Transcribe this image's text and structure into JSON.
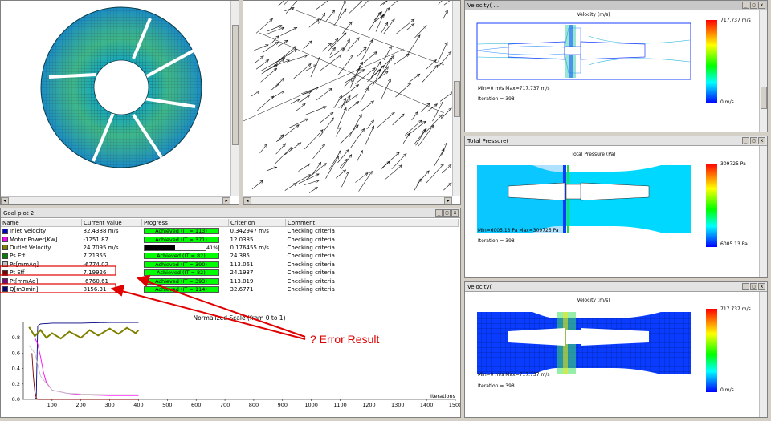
{
  "panes": {
    "velocity_top_title": "Velocity( ... ",
    "total_pressure_title": "Total Pressure(",
    "velocity_bottom_title": "Velocity("
  },
  "goal_plot": {
    "title": "Goal plot 2",
    "headers": [
      "Name",
      "Current Value",
      "Progress",
      "Criterion",
      "Comment"
    ],
    "rows": [
      {
        "name": "Inlet Velocity",
        "value": "82.4388 m/s",
        "progress": "Achieved (IT = 113)",
        "criterion": "0.342947 m/s",
        "comment": "Checking criteria",
        "color": "#0000cc"
      },
      {
        "name": "Motor Power[Kw]",
        "value": "-1251.87",
        "progress": "Achieved (IT = 371)",
        "criterion": "12.0385",
        "comment": "Checking criteria",
        "color": "#ff00ff"
      },
      {
        "name": "Outlet Velocity",
        "value": "24.7095 m/s",
        "progress": "41%",
        "progress_fraction": 0.41,
        "criterion": "0.176455 m/s",
        "comment": "Checking criteria",
        "color": "#808000"
      },
      {
        "name": "Ps Eff",
        "value": "7.21355",
        "progress": "Achieved (IT = 82)",
        "criterion": "24.385",
        "comment": "Checking criteria",
        "color": "#008000"
      },
      {
        "name": "Ps[mmAq]",
        "value": "-6774.02",
        "progress": "Achieved (IT = 390)",
        "criterion": "113.061",
        "comment": "Checking criteria",
        "color": "#c0c0c0"
      },
      {
        "name": "Pt Eff",
        "value": "7.19926",
        "progress": "Achieved (IT = 82)",
        "criterion": "24.1937",
        "comment": "Checking criteria",
        "color": "#800000"
      },
      {
        "name": "Pt[mmAq]",
        "value": "-6760.61",
        "progress": "Achieved (IT = 393)",
        "criterion": "113.019",
        "comment": "Checking criteria",
        "color": "#800080"
      },
      {
        "name": "Q[m3min]",
        "value": "8156.31",
        "progress": "Achieved (IT = 114)",
        "criterion": "32.6771",
        "comment": "Checking criteria",
        "color": "#000080"
      }
    ]
  },
  "annotation": "? Error Result",
  "contours": {
    "top": {
      "title": "Velocity (m/s)",
      "max_label": "717.737 m/s",
      "min_label": "0 m/s",
      "minmax": "Min=0 m/s   Max=717.737 m/s",
      "iteration": "Iteration = 398"
    },
    "middle": {
      "title": "Total Pressure (Pa)",
      "max_label": "309725 Pa",
      "min_label": "6005.13 Pa",
      "minmax": "Min=6005.13 Pa   Max=309725 Pa",
      "iteration": "Iteration = 398"
    },
    "bottom": {
      "title": "Velocity (m/s)",
      "max_label": "717.737 m/s",
      "min_label": "0 m/s",
      "minmax": "Min=0 m/s   Max=717.737 m/s",
      "iteration": "Iteration = 398"
    }
  },
  "colors": {
    "colorbar_top": "#ff0000",
    "colorbar_bottom": "#0000ff",
    "annotation": "#e00000",
    "achieved": "#00ff00"
  },
  "chart_data": {
    "type": "line",
    "title": "Normalized Scale (from 0 to 1)",
    "xlabel": "Iterations",
    "ylabel": "",
    "xlim": [
      0,
      1500
    ],
    "ylim": [
      0,
      1.0
    ],
    "x_ticks": [
      100,
      200,
      300,
      400,
      500,
      600,
      700,
      800,
      900,
      1000,
      1100,
      1200,
      1300,
      1400,
      1500
    ],
    "y_ticks": [
      0.0,
      0.2,
      0.4,
      0.6,
      0.8
    ],
    "series": [
      {
        "color": "#000080",
        "x": [
          40,
          45,
          50,
          55,
          60,
          100,
          200,
          300,
          400
        ],
        "y": [
          0.0,
          0.02,
          0.95,
          0.97,
          0.98,
          0.99,
          0.99,
          1.0,
          1.0
        ]
      },
      {
        "color": "#ff00ff",
        "x": [
          40,
          50,
          60,
          70,
          80,
          100,
          150,
          200,
          300,
          400
        ],
        "y": [
          0.8,
          0.72,
          0.55,
          0.35,
          0.22,
          0.12,
          0.08,
          0.06,
          0.05,
          0.05
        ]
      },
      {
        "color": "#808000",
        "x": [
          20,
          40,
          60,
          80,
          100,
          130,
          160,
          200,
          230,
          260,
          300,
          330,
          360,
          390,
          400
        ],
        "y": [
          0.94,
          0.82,
          0.9,
          0.8,
          0.86,
          0.79,
          0.88,
          0.8,
          0.9,
          0.83,
          0.92,
          0.85,
          0.93,
          0.86,
          0.9
        ]
      },
      {
        "color": "#c0c0c0",
        "x": [
          20,
          40,
          60,
          100,
          150,
          200,
          300,
          400
        ],
        "y": [
          0.7,
          0.6,
          0.3,
          0.12,
          0.08,
          0.07,
          0.06,
          0.06
        ]
      },
      {
        "color": "#800000",
        "x": [
          30,
          35,
          40,
          45,
          50,
          400
        ],
        "y": [
          0.6,
          0.3,
          0.1,
          0.02,
          0.0,
          0.0
        ]
      }
    ]
  }
}
